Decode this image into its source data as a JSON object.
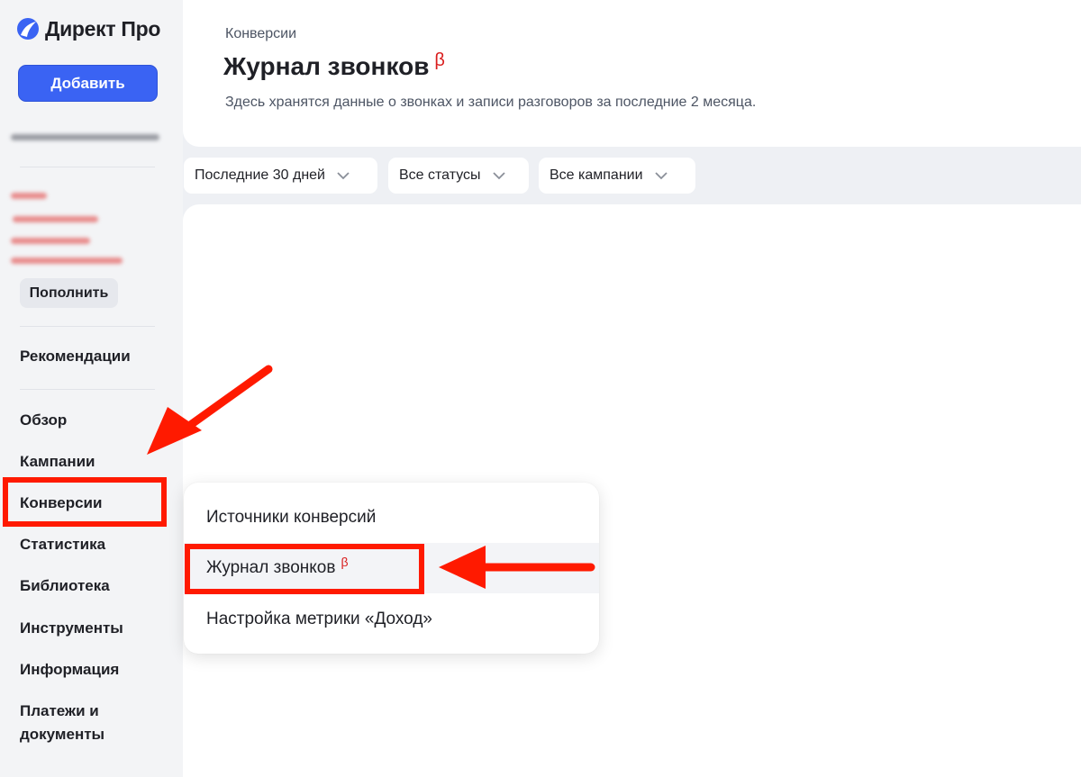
{
  "sidebar": {
    "logo_text": "Директ Про",
    "add_button": "Добавить",
    "topup_button": "Пополнить",
    "items": [
      {
        "label": "Рекомендации"
      },
      {
        "label": "Обзор"
      },
      {
        "label": "Кампании"
      },
      {
        "label": "Конверсии"
      },
      {
        "label": "Статистика"
      },
      {
        "label": "Библиотека"
      },
      {
        "label": "Инструменты"
      },
      {
        "label": "Информация"
      },
      {
        "label": "Платежи и документы"
      }
    ]
  },
  "header": {
    "breadcrumb": "Конверсии",
    "title": "Журнал звонков",
    "beta": "β",
    "subtitle": "Здесь хранятся данные о звонках и записи разговоров за последние 2 месяца."
  },
  "filters": [
    {
      "label": "Последние 30 дней"
    },
    {
      "label": "Все статусы"
    },
    {
      "label": "Все кампании"
    }
  ],
  "dropdown": {
    "items": [
      {
        "label": "Источники конверсий"
      },
      {
        "label": "Журнал звонков",
        "beta": "β"
      },
      {
        "label": "Настройка метрики «Доход»"
      }
    ]
  },
  "colors": {
    "accent": "#3a63f3",
    "annotation_red": "#ff1a00",
    "beta_red": "#d91e1e"
  }
}
